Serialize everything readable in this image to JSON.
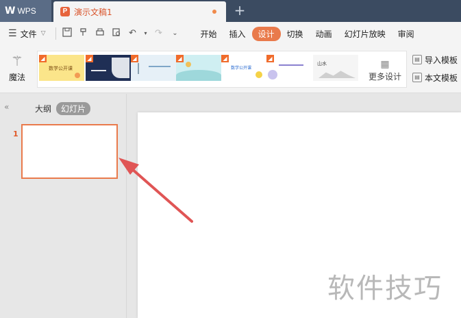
{
  "titlebar": {
    "app_logo": "W",
    "app_name": "WPS",
    "doc_icon": "P",
    "doc_name": "演示文稿1",
    "new_tab": "+"
  },
  "menubar": {
    "file_label": "文件",
    "tabs": [
      {
        "label": "开始",
        "active": false
      },
      {
        "label": "插入",
        "active": false
      },
      {
        "label": "设计",
        "active": true
      },
      {
        "label": "切换",
        "active": false
      },
      {
        "label": "动画",
        "active": false
      },
      {
        "label": "幻灯片放映",
        "active": false
      },
      {
        "label": "审阅",
        "active": false
      }
    ]
  },
  "ribbon": {
    "magic_label": "魔法",
    "more_design_label": "更多设计",
    "import_template_label": "导入模板",
    "this_template_label": "本文模板",
    "templates": [
      {
        "name": "数学公开课",
        "bg": "#fbe58a"
      },
      {
        "name": "",
        "bg": "#1f2f55"
      },
      {
        "name": "",
        "bg": "#e6f0f7"
      },
      {
        "name": "",
        "bg": "#cfeff2"
      },
      {
        "name": "数学公开课",
        "bg": "#ffffff"
      },
      {
        "name": "",
        "bg": "#ffffff"
      },
      {
        "name": "山水",
        "bg": "#f5f5f5"
      }
    ]
  },
  "leftpane": {
    "tab_outline": "大纲",
    "tab_slides": "幻灯片",
    "slide_number": "1"
  },
  "watermark": "软件技巧",
  "colors": {
    "accent": "#e97a4b",
    "titlebar": "#3b4b61",
    "arrow": "#e05555"
  }
}
